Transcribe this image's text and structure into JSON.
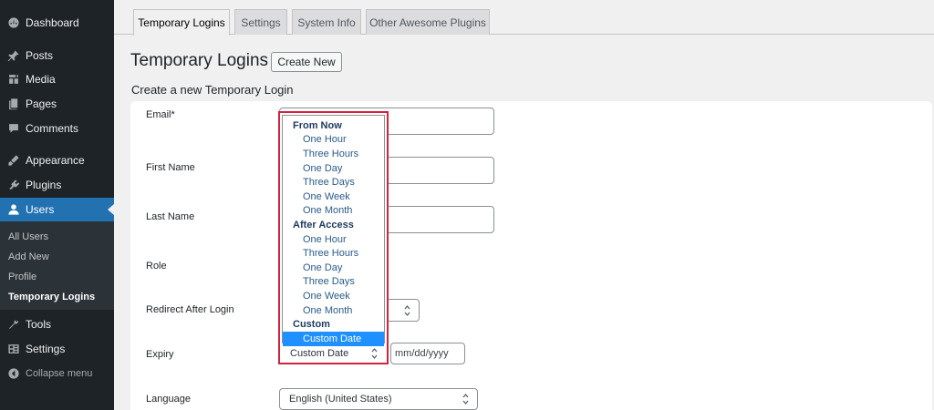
{
  "sidebar": {
    "items": [
      {
        "label": "Dashboard",
        "icon": "dashboard-icon"
      },
      {
        "label": "Posts",
        "icon": "pin-icon"
      },
      {
        "label": "Media",
        "icon": "media-icon"
      },
      {
        "label": "Pages",
        "icon": "pages-icon"
      },
      {
        "label": "Comments",
        "icon": "comment-icon"
      },
      {
        "label": "Appearance",
        "icon": "brush-icon"
      },
      {
        "label": "Plugins",
        "icon": "plugin-icon"
      },
      {
        "label": "Users",
        "icon": "user-icon",
        "active": true
      },
      {
        "label": "Tools",
        "icon": "wrench-icon"
      },
      {
        "label": "Settings",
        "icon": "settings-icon"
      }
    ],
    "submenu": [
      "All Users",
      "Add New",
      "Profile",
      "Temporary Logins"
    ],
    "submenu_current": "Temporary Logins",
    "collapse_label": "Collapse menu",
    "colors": {
      "background": "#1d2327",
      "active": "#2271b1"
    }
  },
  "tabs": [
    "Temporary Logins",
    "Settings",
    "System Info",
    "Other Awesome Plugins"
  ],
  "active_tab": "Temporary Logins",
  "header": {
    "title": "Temporary Logins",
    "create_new_label": "Create New",
    "section_title": "Create a new Temporary Login"
  },
  "form": {
    "labels": {
      "email": "Email*",
      "first_name": "First Name",
      "last_name": "Last Name",
      "role": "Role",
      "redirect": "Redirect After Login",
      "expiry": "Expiry",
      "language": "Language"
    },
    "language_value": "English (United States)",
    "date_placeholder": "mm/dd/yyyy"
  },
  "expiry_dropdown": {
    "groups": [
      {
        "label": "From Now",
        "options": [
          "One Hour",
          "Three Hours",
          "One Day",
          "Three Days",
          "One Week",
          "One Month"
        ]
      },
      {
        "label": "After Access",
        "options": [
          "One Hour",
          "Three Hours",
          "One Day",
          "Three Days",
          "One Week",
          "One Month"
        ]
      },
      {
        "label": "Custom",
        "options": [
          "Custom Date"
        ]
      }
    ],
    "selected": "Custom Date",
    "current_value": "Custom Date",
    "highlight_color": "#d1233d",
    "selected_color": "#1e90ff"
  }
}
